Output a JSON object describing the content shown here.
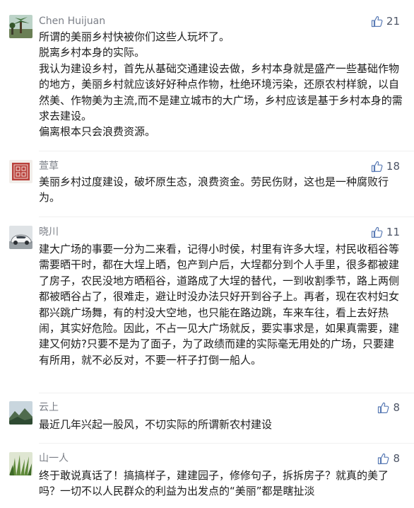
{
  "comments": [
    {
      "author": "Chen Huijuan",
      "likes": "21",
      "avatar_icon": "palm-tree-avatar",
      "lines": [
        "所谓的美丽乡村快被你们这些人玩坏了。",
        "脱离乡村本身的实际。",
        "我认为建设乡村，首先从基础交通建设去做，乡村本身就是盛产一些基础作物的地方，美丽乡村就应该好好种点作物，杜绝环境污染，还原农村样貌，以自然美、作物美为主流,而不是建立城市的大广场，乡村应该是基于乡村本身的需求去建设。",
        "偏离根本只会浪费资源。"
      ]
    },
    {
      "author": "萱草",
      "likes": "18",
      "avatar_icon": "red-seal-avatar",
      "lines": [
        "美丽乡村过度建设，破坏原生态，浪费资金。劳民伤财，这也是一种腐败行为。"
      ]
    },
    {
      "author": "晓川",
      "likes": "11",
      "avatar_icon": "car-avatar",
      "lines": [
        "建大广场的事要一分为二来看，记得小时侯，村里有许多大埕，村民收稻谷等需要晒干时，都在大埕上晒，包产到户后，大埕都分到个人手里，很多都被建了房子，农民没地方晒稻谷，道路成了大埕的替代，一到收割季节，路上两侧都被晒谷占了，很难走，避让时没办法只好开到谷子上。再者，现在农村妇女都兴跳广场舞，有的村没大空地，也只能在路边跳，车来车往，看上去好热闹，其实好危险。因此，不占一见大广场就反，要实事求是，如果真需要，建建又何妨?只要不是为了面子，为了政绩而建的实际毫无用处的广场，只要建有所用，就不必反对，不要一杆子打倒一船人。"
      ]
    },
    {
      "author": "云上",
      "likes": "8",
      "avatar_icon": "mountain-avatar",
      "lines": [
        "最近几年兴起一股风，不切实际的所谓新农村建设"
      ]
    },
    {
      "author": "山一人",
      "likes": "8",
      "avatar_icon": "grass-avatar",
      "lines": [
        "终于敢说真话了！搞搞样子，建建园子，修修句子，拆拆房子？就真的美了吗？一切不以人民群众的利益为出发点的“美丽”都是瞎扯淡"
      ]
    }
  ]
}
